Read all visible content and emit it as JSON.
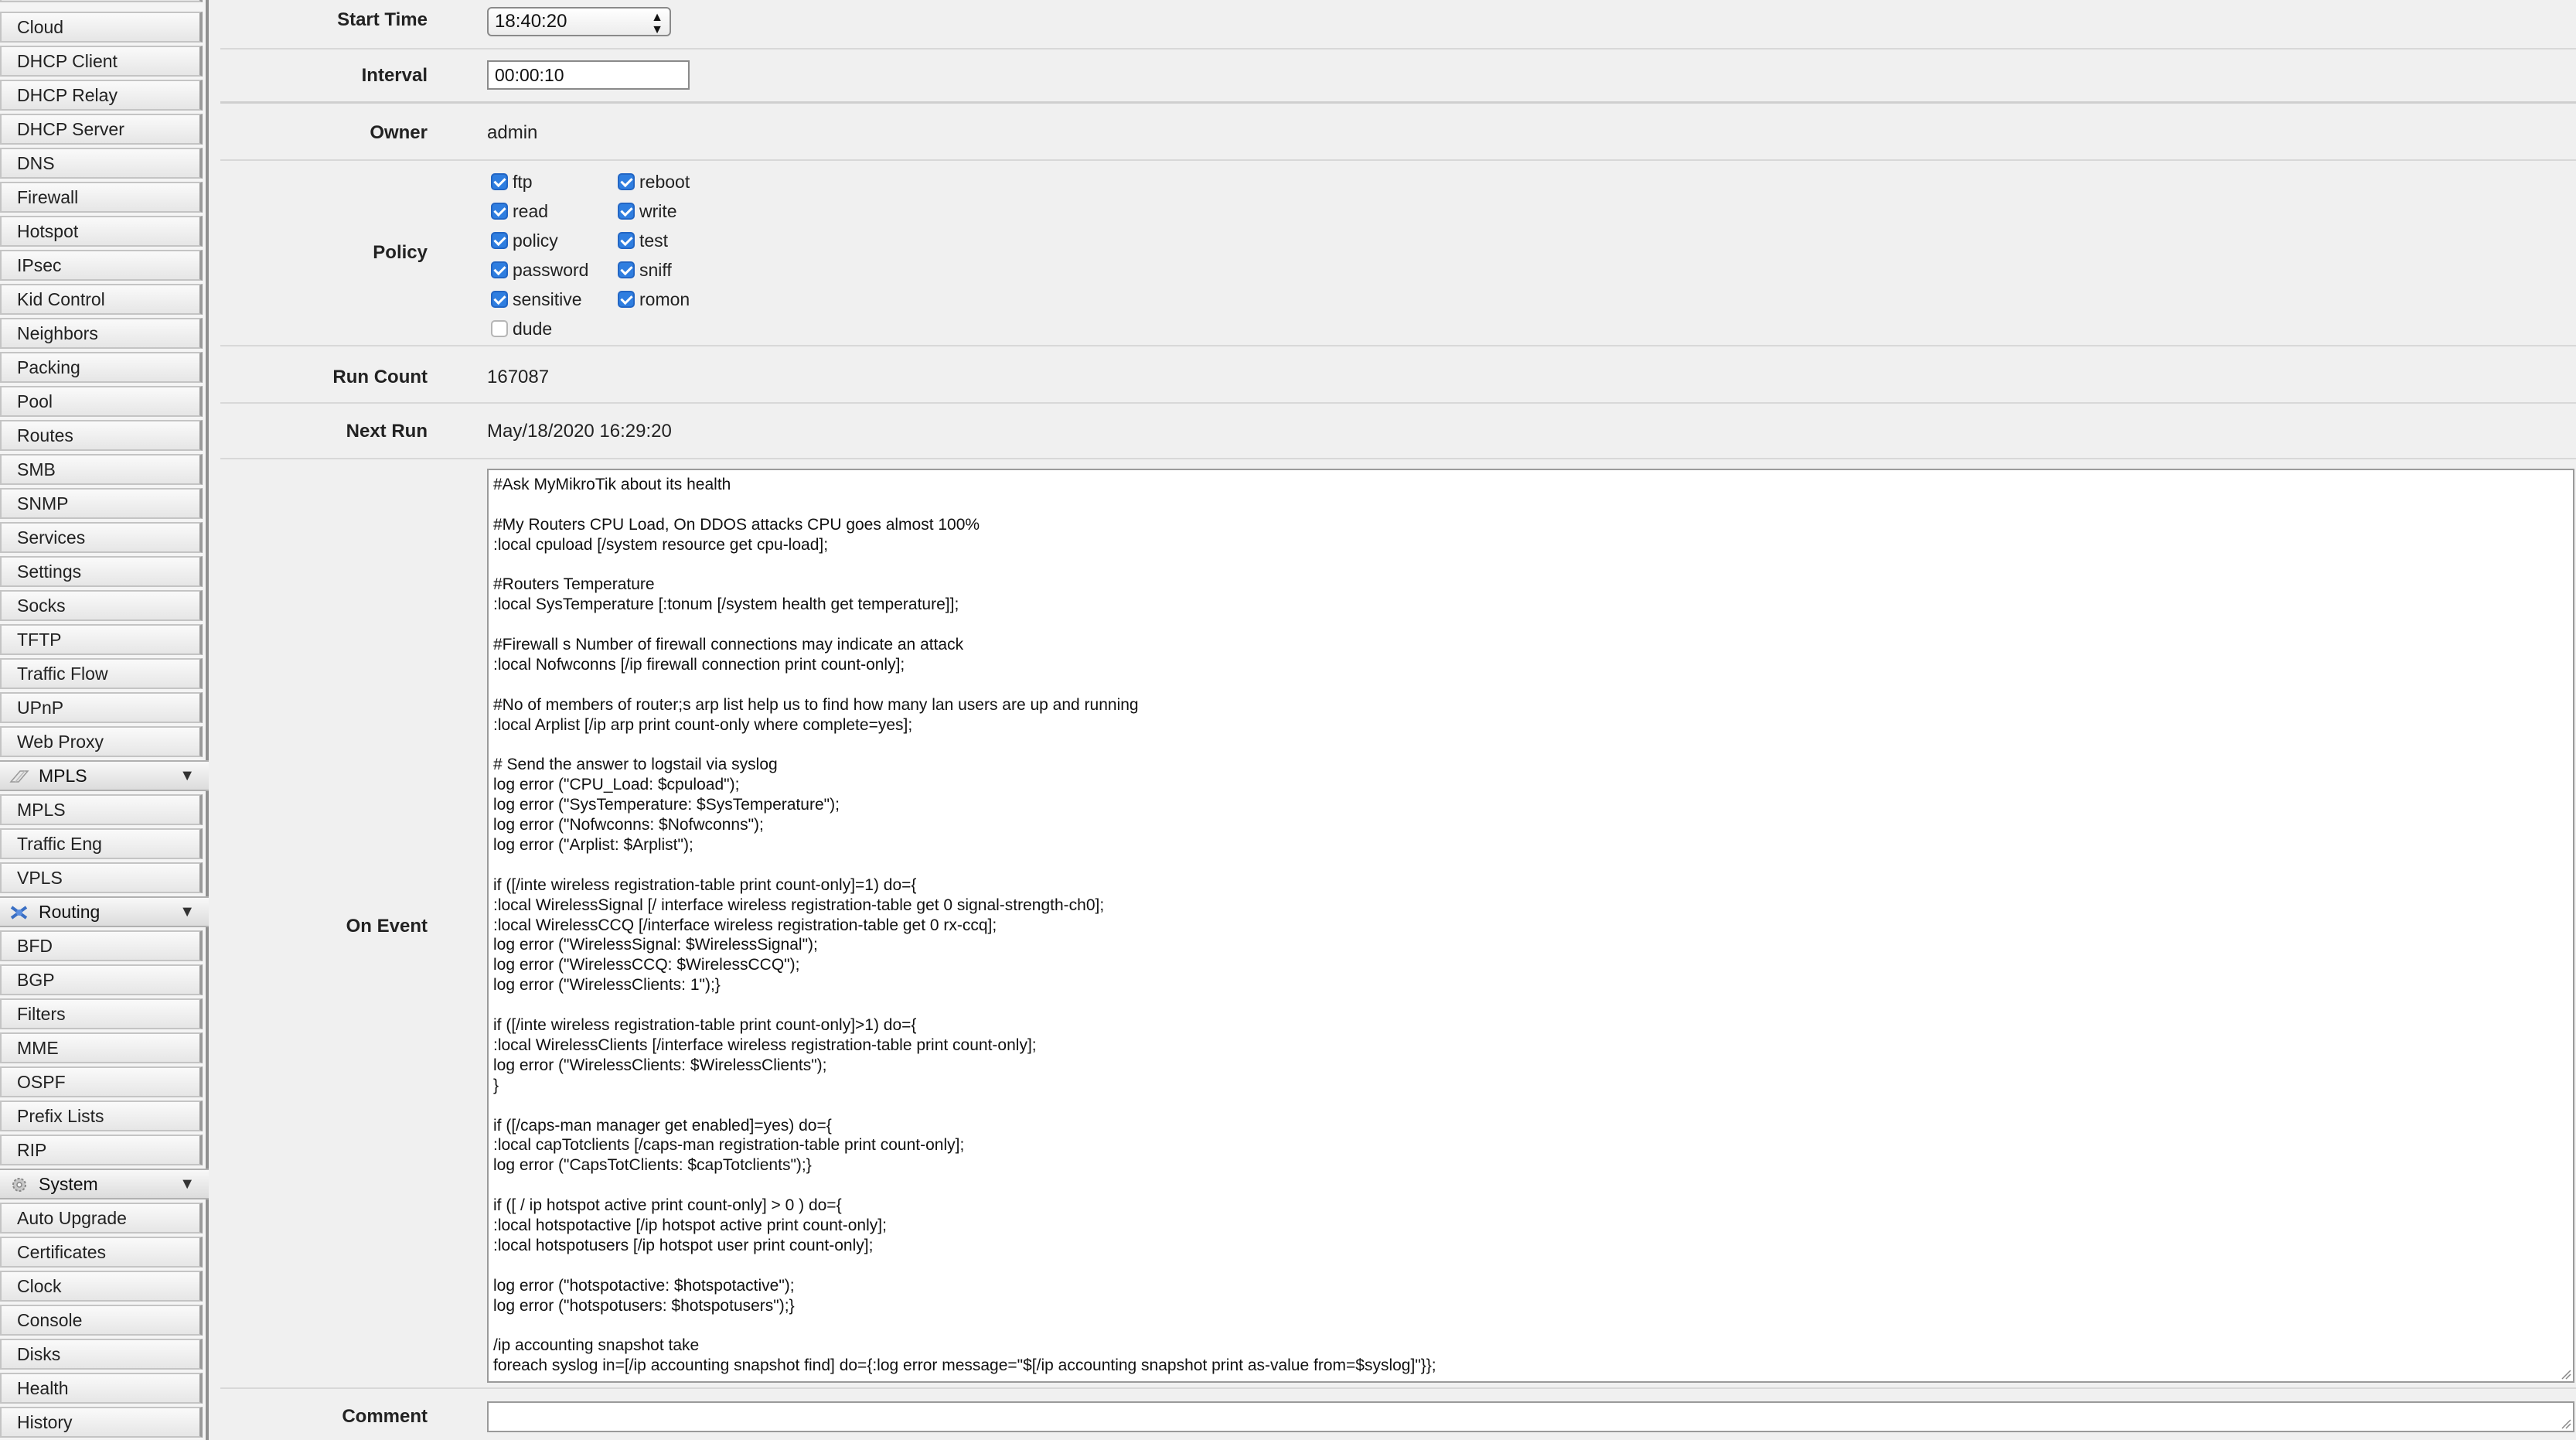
{
  "sidebar": {
    "items_top": [
      "Cloud",
      "DHCP Client",
      "DHCP Relay",
      "DHCP Server",
      "DNS",
      "Firewall",
      "Hotspot",
      "IPsec",
      "Kid Control",
      "Neighbors",
      "Packing",
      "Pool",
      "Routes",
      "SMB",
      "SNMP",
      "Services",
      "Settings",
      "Socks",
      "TFTP",
      "Traffic Flow",
      "UPnP",
      "Web Proxy"
    ],
    "mpls": {
      "label": "MPLS",
      "items": [
        "MPLS",
        "Traffic Eng",
        "VPLS"
      ]
    },
    "routing": {
      "label": "Routing",
      "items": [
        "BFD",
        "BGP",
        "Filters",
        "MME",
        "OSPF",
        "Prefix Lists",
        "RIP"
      ]
    },
    "system": {
      "label": "System",
      "items": [
        "Auto Upgrade",
        "Certificates",
        "Clock",
        "Console",
        "Disks",
        "Health",
        "History"
      ]
    }
  },
  "form": {
    "start_time": {
      "label": "Start Time",
      "value": "18:40:20"
    },
    "interval": {
      "label": "Interval",
      "value": "00:00:10"
    },
    "owner": {
      "label": "Owner",
      "value": "admin"
    },
    "policy": {
      "label": "Policy",
      "col1": [
        {
          "name": "ftp",
          "checked": true
        },
        {
          "name": "read",
          "checked": true
        },
        {
          "name": "policy",
          "checked": true
        },
        {
          "name": "password",
          "checked": true
        },
        {
          "name": "sensitive",
          "checked": true
        },
        {
          "name": "dude",
          "checked": false
        }
      ],
      "col2": [
        {
          "name": "reboot",
          "checked": true
        },
        {
          "name": "write",
          "checked": true
        },
        {
          "name": "test",
          "checked": true
        },
        {
          "name": "sniff",
          "checked": true
        },
        {
          "name": "romon",
          "checked": true
        }
      ]
    },
    "run_count": {
      "label": "Run Count",
      "value": "167087"
    },
    "next_run": {
      "label": "Next Run",
      "value": "May/18/2020 16:29:20"
    },
    "on_event": {
      "label": "On Event",
      "lines": [
        "#Ask MyMikroTik about its health",
        "",
        "#My Routers CPU Load, On DDOS attacks CPU goes almost 100%",
        ":local cpuload [/system resource get cpu-load];",
        "",
        "#Routers Temperature",
        ":local SysTemperature [:tonum [/system health get temperature]];",
        "",
        "#Firewall s Number of firewall connections may indicate an attack",
        ":local Nofwconns [/ip firewall connection print count-only];",
        "",
        "#No of members of router;s arp list help us to find how many lan users are up and running",
        ":local Arplist [/ip arp print count-only where complete=yes];",
        "",
        "# Send the answer to logstail via syslog",
        "log error (\"CPU_Load: $cpuload\");",
        "log error (\"SysTemperature: $SysTemperature\");",
        "log error (\"Nofwconns: $Nofwconns\");",
        "log error (\"Arplist: $Arplist\");",
        "",
        "if ([/inte wireless registration-table print count-only]=1) do={",
        ":local WirelessSignal [/ interface wireless registration-table get 0 signal-strength-ch0];",
        ":local WirelessCCQ [/interface wireless registration-table get 0 rx-ccq];",
        "log error (\"WirelessSignal: $WirelessSignal\");",
        "log error (\"WirelessCCQ: $WirelessCCQ\");",
        "log error (\"WirelessClients: 1\");}",
        "",
        "if ([/inte wireless registration-table print count-only]>1) do={",
        ":local WirelessClients [/interface wireless registration-table print count-only];",
        "log error (\"WirelessClients: $WirelessClients\");",
        "}",
        "",
        "if ([/caps-man manager get enabled]=yes) do={",
        ":local capTotclients [/caps-man registration-table print count-only];",
        "log error (\"CapsTotClients: $capTotclients\");}",
        "",
        "if ([ / ip hotspot active print count-only] > 0 ) do={",
        ":local hotspotactive [/ip hotspot active print count-only];",
        ":local hotspotusers [/ip hotspot user print count-only];",
        "",
        "log error (\"hotspotactive: $hotspotactive\");",
        "log error (\"hotspotusers: $hotspotusers\");}",
        "",
        "/ip accounting snapshot take",
        "foreach syslog in=[/ip accounting snapshot find] do={:log error message=\"$[/ip accounting snapshot print as-value from=$syslog]\"}};"
      ]
    },
    "comment": {
      "label": "Comment",
      "value": ""
    }
  },
  "colors": {
    "checkbox_on": "#2f7ee0",
    "background": "#f0f0f0"
  }
}
